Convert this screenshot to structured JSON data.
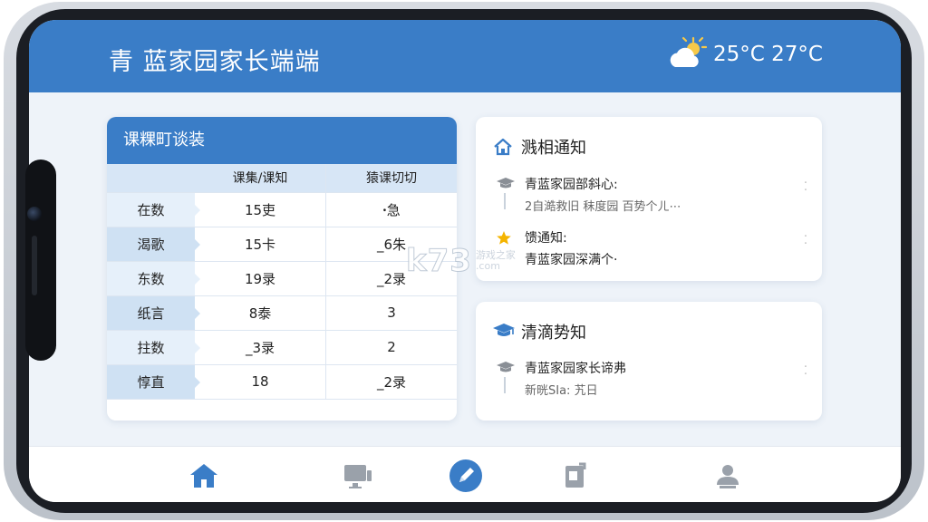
{
  "header": {
    "title": "青 蓝家园家长端端",
    "weather_icon": "partly-cloudy-icon",
    "temperature": "25°C  27°C"
  },
  "schedule": {
    "title": "课粿町谈装",
    "columns": [
      "",
      "课集/课知",
      "猿课切切"
    ],
    "rows": [
      [
        "在数",
        "15吏",
        "ꞏ急"
      ],
      [
        "渴歌",
        "15卡",
        "_6朱"
      ],
      [
        "东数",
        "19录",
        "_2录"
      ],
      [
        "纸言",
        "8泰",
        "3"
      ],
      [
        "拄数",
        "_3录",
        "2"
      ],
      [
        "惇直",
        "18",
        "_2录"
      ]
    ]
  },
  "notices": {
    "title": "溅相通知",
    "title_icon": "home-icon",
    "items": [
      {
        "icon": "graduation-cap-icon",
        "title": "青蓝家园部斜心:",
        "subtitle": "2自澔救旧 秣度园 百势个ㄦ⋯"
      },
      {
        "icon": "star-icon",
        "title": "馈通知:",
        "subtitle": "青蓝家园深满个·"
      }
    ]
  },
  "school": {
    "title": "清滴势知",
    "title_icon": "graduation-cap-icon",
    "items": [
      {
        "icon": "graduation-cap-icon",
        "title": "青蓝家园家长谛弗",
        "subtitle": "新晄SIa: 艽日"
      }
    ]
  },
  "nav": {
    "items": [
      {
        "name": "nav-home",
        "icon": "home-icon"
      },
      {
        "name": "nav-monitor",
        "icon": "monitor-icon"
      },
      {
        "name": "nav-compose",
        "icon": "pen-icon"
      },
      {
        "name": "nav-docs",
        "icon": "document-icon"
      },
      {
        "name": "nav-profile",
        "icon": "user-icon"
      }
    ]
  },
  "watermark": {
    "logo": "k73",
    "sub1": "游戏之家",
    "sub2": ".com"
  },
  "colors": {
    "primary": "#3a7dc7",
    "accent_star": "#f4b400",
    "background": "#eef3f9"
  }
}
